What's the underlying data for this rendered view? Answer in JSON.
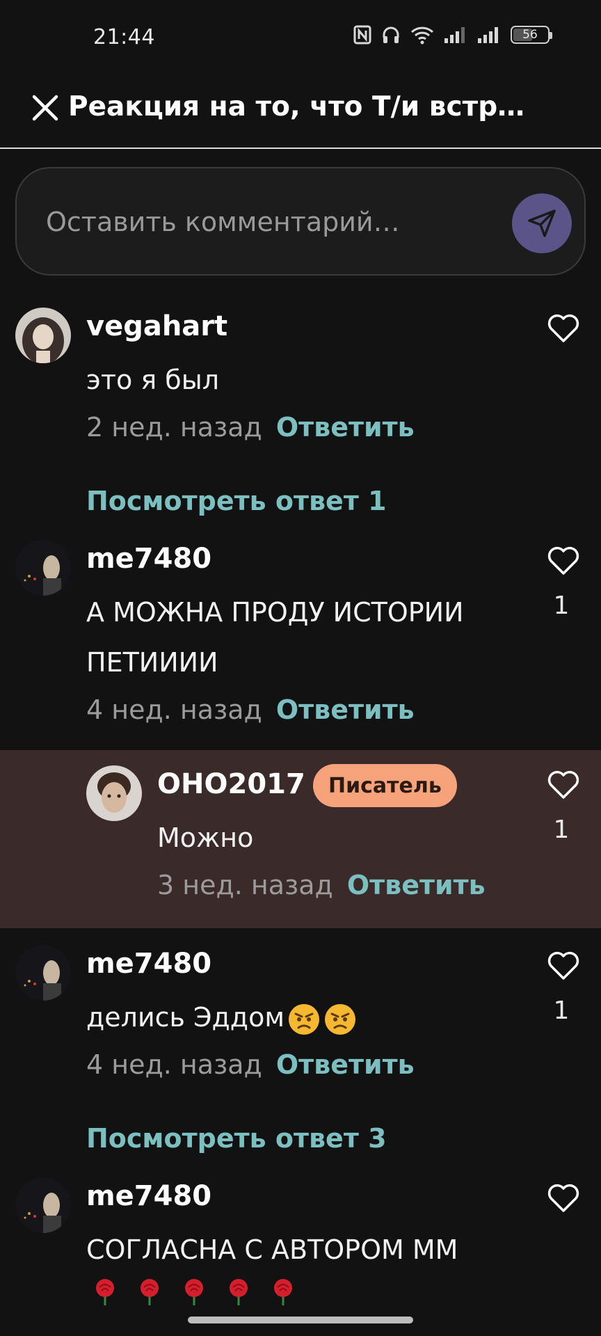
{
  "status_bar": {
    "time": "21:44",
    "battery": "56",
    "battery_fraction": 0.56,
    "icons": [
      "nfc-icon",
      "headphones-icon",
      "wifi-icon",
      "signal-icon",
      "signal-icon",
      "battery-icon"
    ]
  },
  "header": {
    "title": "Реакция на то, что Т/и встр…",
    "close_icon": "close-icon"
  },
  "comment_input": {
    "placeholder": "Оставить комментарий…",
    "value": "",
    "send_icon": "send-icon",
    "send_color": "#5b5488"
  },
  "colors": {
    "background": "#121212",
    "accent_link": "#7bbfc1",
    "reply_highlight": "#3a2b2a",
    "writer_badge": "#f6a37c"
  },
  "comments": [
    {
      "username": "vegahart",
      "text": "это я был",
      "time": "2 нед. назад",
      "reply_label": "Ответить",
      "likes": "",
      "view_replies": "Посмотреть ответ 1"
    },
    {
      "username": "me7480",
      "text": "А МОЖНА ПРОДУ  ИСТОРИИ ПЕТИИИИ",
      "time": "4 нед. назад",
      "reply_label": "Ответить",
      "likes": "1",
      "replies": [
        {
          "username": "OHO2017",
          "badge": "Писатель",
          "text": "Можно",
          "time": "3 нед. назад",
          "reply_label": "Ответить",
          "likes": "1"
        }
      ]
    },
    {
      "username": "me7480",
      "text": "делись Эддом",
      "emojis": [
        "angry-face-emoji",
        "angry-face-emoji"
      ],
      "time": "4 нед. назад",
      "reply_label": "Ответить",
      "likes": "1",
      "view_replies": "Посмотреть ответ 3"
    },
    {
      "username": "me7480",
      "text": "СОГЛАСНА С АВТОРОМ ММ",
      "emojis": [
        "rose-emoji",
        "rose-emoji",
        "rose-emoji",
        "rose-emoji",
        "rose-emoji"
      ],
      "likes": ""
    }
  ]
}
